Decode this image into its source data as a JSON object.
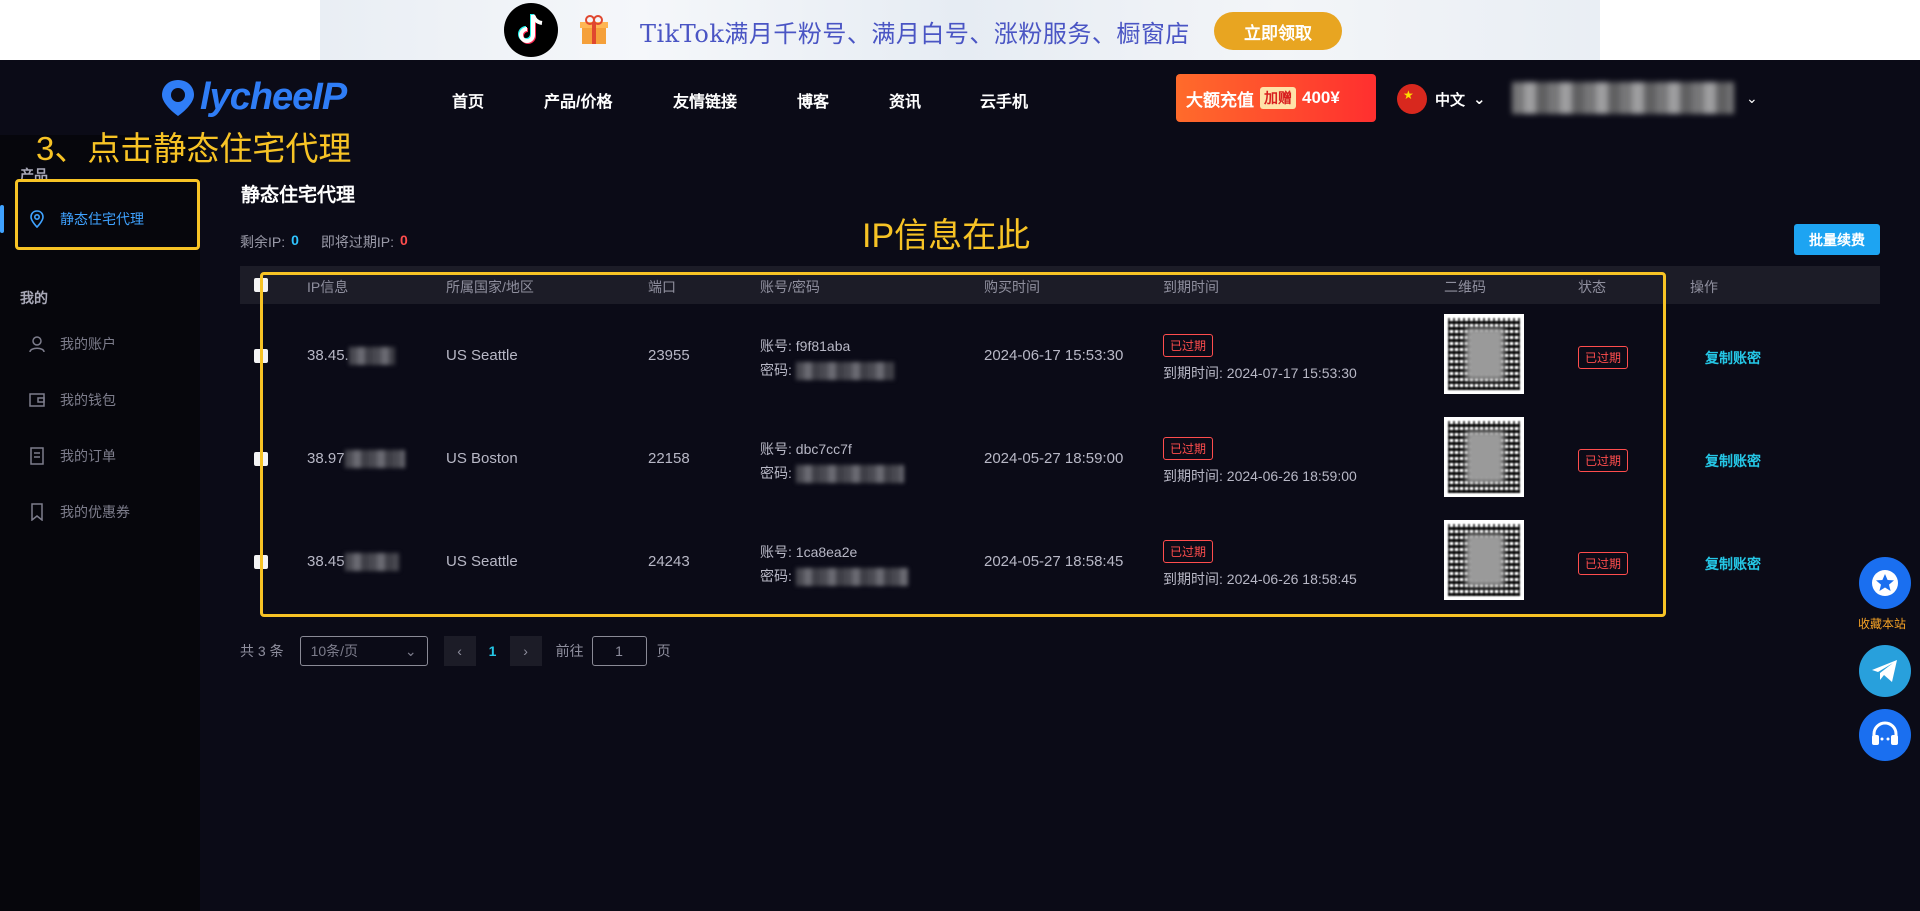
{
  "banner": {
    "text": "TikTok满月千粉号、满月白号、涨粉服务、橱窗店",
    "button": "立即领取"
  },
  "nav": {
    "logo_text": "lycheeIP",
    "items": [
      "首页",
      "产品/价格",
      "友情链接",
      "博客",
      "资讯",
      "云手机"
    ],
    "promo_text": "大额充值",
    "promo_tag": "加赠",
    "promo_amount": "400¥",
    "language": "中文"
  },
  "annotations": {
    "step": "3、点击静态住宅代理",
    "ip_info": "IP信息在此"
  },
  "sidebar": {
    "product_heading": "产品",
    "static_proxy": "静态住宅代理",
    "mine_heading": "我的",
    "items": [
      "我的账户",
      "我的钱包",
      "我的订单",
      "我的优惠券"
    ]
  },
  "main": {
    "title": "静态住宅代理",
    "remaining_label": "剩余IP:",
    "remaining_value": "0",
    "expiring_label": "即将过期IP:",
    "expiring_value": "0",
    "renew_button": "批量续费"
  },
  "table": {
    "headers": [
      "IP信息",
      "所属国家/地区",
      "端口",
      "账号/密码",
      "购买时间",
      "到期时间",
      "二维码",
      "状态",
      "操作"
    ],
    "account_label": "账号:",
    "password_label": "密码:",
    "expiry_prefix": "到期时间:",
    "rows": [
      {
        "ip": "38.45.",
        "location": "US Seattle",
        "port": "23955",
        "account": "f9f81aba",
        "purchase": "2024-06-17 15:53:30",
        "badge": "已过期",
        "expiry": "2024-07-17 15:53:30",
        "status": "已过期",
        "action": "复制账密"
      },
      {
        "ip": "38.97",
        "location": "US Boston",
        "port": "22158",
        "account": "dbc7cc7f",
        "purchase": "2024-05-27 18:59:00",
        "badge": "已过期",
        "expiry": "2024-06-26 18:59:00",
        "status": "已过期",
        "action": "复制账密"
      },
      {
        "ip": "38.45",
        "location": "US Seattle",
        "port": "24243",
        "account": "1ca8ea2e",
        "purchase": "2024-05-27 18:58:45",
        "badge": "已过期",
        "expiry": "2024-06-26 18:58:45",
        "status": "已过期",
        "action": "复制账密"
      }
    ]
  },
  "pagination": {
    "total": "共 3 条",
    "page_size": "10条/页",
    "current_page": "1",
    "goto_label": "前往",
    "goto_value": "1",
    "page_suffix": "页"
  },
  "floating": {
    "favorite_label": "收藏本站"
  },
  "colors": {
    "accent": "#2fc4ff",
    "annotation": "#f7c325",
    "expired": "#ff4d4d",
    "brand": "#2f7df6"
  }
}
